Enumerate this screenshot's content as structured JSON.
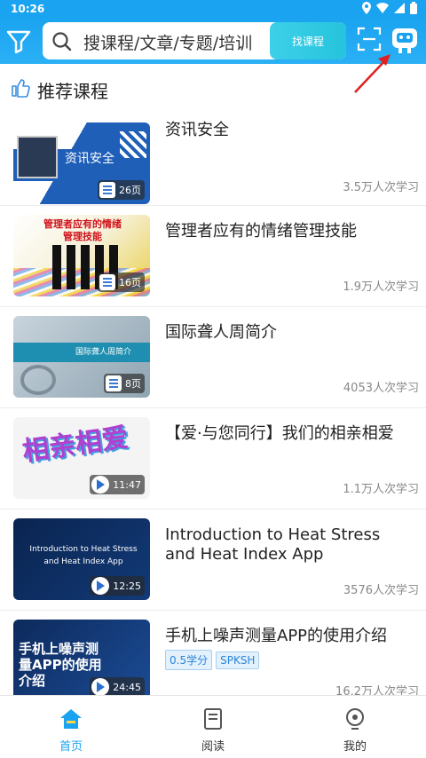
{
  "status": {
    "time": "10:26"
  },
  "header": {
    "search_placeholder": "搜课程/文章/专题/培训",
    "search_button": "找课程"
  },
  "section": {
    "title": "推荐课程"
  },
  "courses": [
    {
      "title": "资讯安全",
      "badge": "26页",
      "type": "doc",
      "count": "3.5万人次学习",
      "thumb_text": "资讯安全"
    },
    {
      "title": "管理者应有的情绪管理技能",
      "badge": "16页",
      "type": "doc",
      "count": "1.9万人次学习",
      "thumb_text": "管理者应有的情绪管理技能"
    },
    {
      "title": "国际聋人周简介",
      "badge": "8页",
      "type": "doc",
      "count": "4053人次学习",
      "thumb_text": "国际聋人周简介"
    },
    {
      "title": "【爱·与您同行】我们的相亲相爱",
      "badge": "11:47",
      "type": "video",
      "count": "1.1万人次学习",
      "thumb_text": "相亲相爱"
    },
    {
      "title": "Introduction to Heat Stress and Heat Index App",
      "badge": "12:25",
      "type": "video",
      "count": "3576人次学习",
      "thumb_text": "Introduction to Heat Stress and Heat Index App"
    },
    {
      "title": "手机上噪声测量APP的使用介绍",
      "badge": "24:45",
      "type": "video",
      "count": "16.2万人次学习",
      "thumb_text": "手机上噪声测量APP的使用介绍",
      "tags": [
        "0.5学分",
        "SPKSH"
      ]
    }
  ],
  "tabs": [
    {
      "label": "首页",
      "icon": "home-icon"
    },
    {
      "label": "阅读",
      "icon": "book-icon"
    },
    {
      "label": "我的",
      "icon": "profile-icon"
    }
  ],
  "colors": {
    "accent": "#1aa3f0",
    "search_button": "#2cc7e0"
  }
}
